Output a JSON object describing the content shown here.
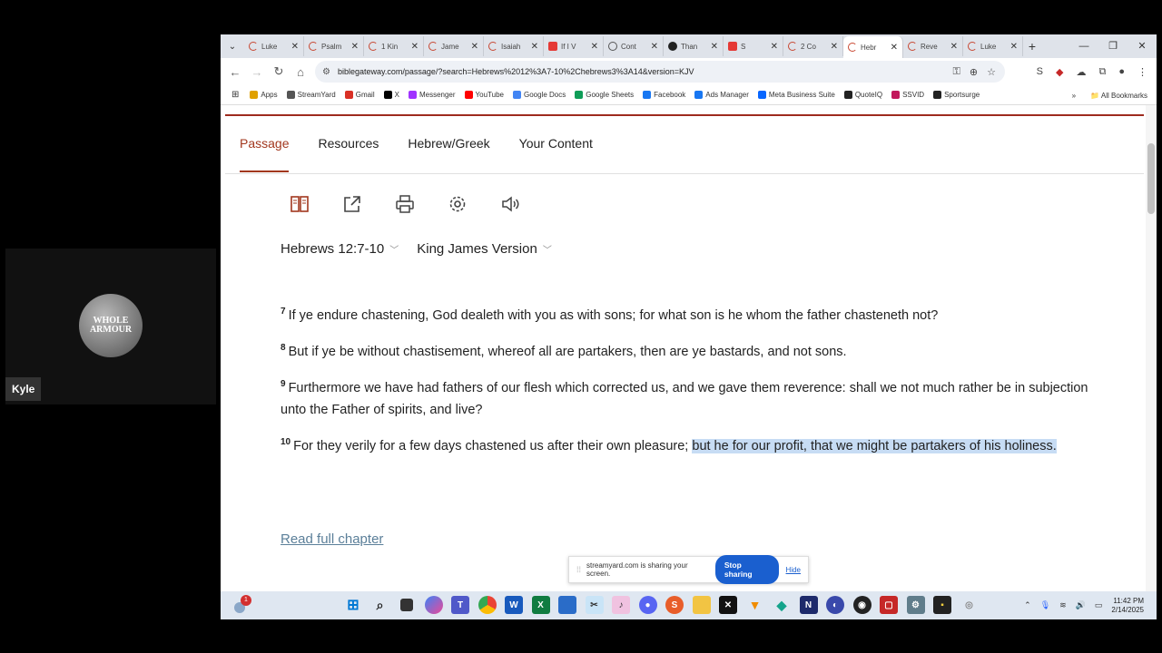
{
  "participant": {
    "name": "Kyle",
    "logo_text_1": "WHOLE",
    "logo_text_2": "ARMOUR"
  },
  "browser": {
    "tabs": [
      {
        "title": "Luke",
        "icon": "biblegateway"
      },
      {
        "title": "Psalm",
        "icon": "biblegateway"
      },
      {
        "title": "1 Kin",
        "icon": "biblegateway"
      },
      {
        "title": "Jame",
        "icon": "biblegateway"
      },
      {
        "title": "Isaiah",
        "icon": "biblegateway"
      },
      {
        "title": "If I V",
        "icon": "youtube"
      },
      {
        "title": "Cont",
        "icon": "globe"
      },
      {
        "title": "Than",
        "icon": "threads"
      },
      {
        "title": "S",
        "icon": "streamyard-recording"
      },
      {
        "title": "2 Co",
        "icon": "biblegateway"
      },
      {
        "title": "Hebr",
        "icon": "biblegateway",
        "active": true
      },
      {
        "title": "Reve",
        "icon": "biblegateway"
      },
      {
        "title": "Luke",
        "icon": "biblegateway"
      }
    ],
    "url": "biblegateway.com/passage/?search=Hebrews%2012%3A7-10%2Chebrews3%3A14&version=KJV",
    "bookmarks": [
      {
        "label": "Apps",
        "color": "#e0a100"
      },
      {
        "label": "StreamYard",
        "color": "#555555"
      },
      {
        "label": "Gmail",
        "color": "#d93025"
      },
      {
        "label": "X",
        "color": "#000000"
      },
      {
        "label": "Messenger",
        "color": "#a033ff"
      },
      {
        "label": "YouTube",
        "color": "#ff0000"
      },
      {
        "label": "Google Docs",
        "color": "#4285f4"
      },
      {
        "label": "Google Sheets",
        "color": "#0f9d58"
      },
      {
        "label": "Facebook",
        "color": "#1877f2"
      },
      {
        "label": "Ads Manager",
        "color": "#1877f2"
      },
      {
        "label": "Meta Business Suite",
        "color": "#0866ff"
      },
      {
        "label": "QuoteIQ",
        "color": "#222222"
      },
      {
        "label": "SSVID",
        "color": "#c2185b"
      },
      {
        "label": "Sportsurge",
        "color": "#222222"
      }
    ],
    "all_bookmarks": "All Bookmarks"
  },
  "page": {
    "nav_tabs": [
      "Passage",
      "Resources",
      "Hebrew/Greek",
      "Your Content"
    ],
    "reference": "Hebrews 12:7-10",
    "version": "King James Version",
    "verses": [
      {
        "num": "7",
        "text": "If ye endure chastening, God dealeth with you as with sons; for what son is he whom the father chasteneth not?"
      },
      {
        "num": "8",
        "text": "But if ye be without chastisement, whereof all are partakers, then are ye bastards, and not sons."
      },
      {
        "num": "9",
        "text": "Furthermore we have had fathers of our flesh which corrected us, and we gave them reverence: shall we not much rather be in subjection unto the Father of spirits, and live?"
      },
      {
        "num": "10",
        "text_plain": "For they verily for a few days chastened us after their own pleasure; ",
        "text_highlight": "but he for our profit, that we might be partakers of his holiness."
      }
    ],
    "read_full_chapter": "Read full chapter"
  },
  "share_bar": {
    "message": "streamyard.com is sharing your screen.",
    "stop_label": "Stop sharing",
    "hide_label": "Hide"
  },
  "taskbar": {
    "notification_count": "1",
    "time": "11:42 PM",
    "date": "2/14/2025"
  }
}
